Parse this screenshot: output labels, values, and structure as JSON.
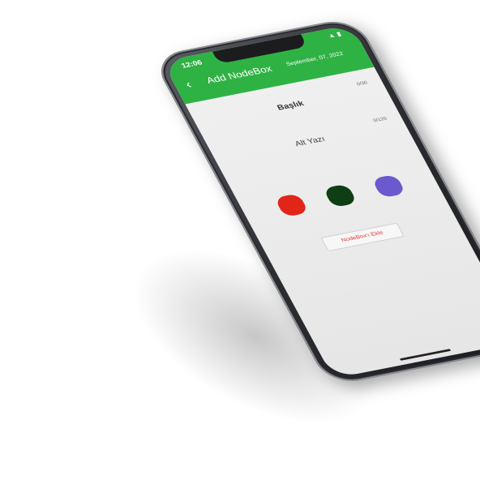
{
  "status_bar": {
    "time": "12:06",
    "icons": "▲ ▮"
  },
  "app_bar": {
    "back_icon": "‹",
    "title": "Add NodeBox",
    "date": "September, 07, 2022"
  },
  "form": {
    "title_field": {
      "label": "Başlık",
      "counter": "0/30"
    },
    "subtitle_field": {
      "label": "Alt Yazı",
      "counter": "0/120"
    }
  },
  "colors": [
    {
      "name": "red",
      "hex": "#e12619"
    },
    {
      "name": "dark-green",
      "hex": "#0f3d14"
    },
    {
      "name": "purple",
      "hex": "#6a5acd"
    }
  ],
  "add_button": {
    "label": "NodeBox'ı Ekle",
    "color": "#e53935"
  },
  "theme": {
    "accent": "#2fb244",
    "background": "#eeeeee"
  }
}
